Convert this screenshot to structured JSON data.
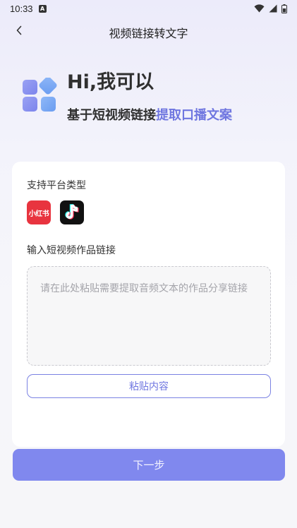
{
  "status_bar": {
    "time": "10:33",
    "icons": [
      "notification-a-icon",
      "wifi-icon",
      "signal-icon",
      "battery-icon"
    ]
  },
  "appbar": {
    "title": "视频链接转文字",
    "back_icon": "chevron-left-icon"
  },
  "hero": {
    "title": "Hi,我可以",
    "subtitle_plain": "基于短视频链接",
    "subtitle_highlight": "提取口播文案",
    "logo_icon": "apps-grid-icon"
  },
  "card": {
    "platform_label": "支持平台类型",
    "platforms": [
      {
        "name": "小红书",
        "icon": "xiaohongshu-icon",
        "color": "#e8343f"
      },
      {
        "name": "douyin",
        "icon": "douyin-icon",
        "color": "#111111"
      }
    ],
    "link_label": "输入短视频作品链接",
    "link_placeholder": "请在此处粘贴需要提取音频文本的作品分享链接",
    "paste_button": "粘贴内容"
  },
  "next_button": "下一步",
  "colors": {
    "accent": "#6f76e0",
    "primary_button": "#8088ee",
    "card_background": "#ffffff"
  }
}
